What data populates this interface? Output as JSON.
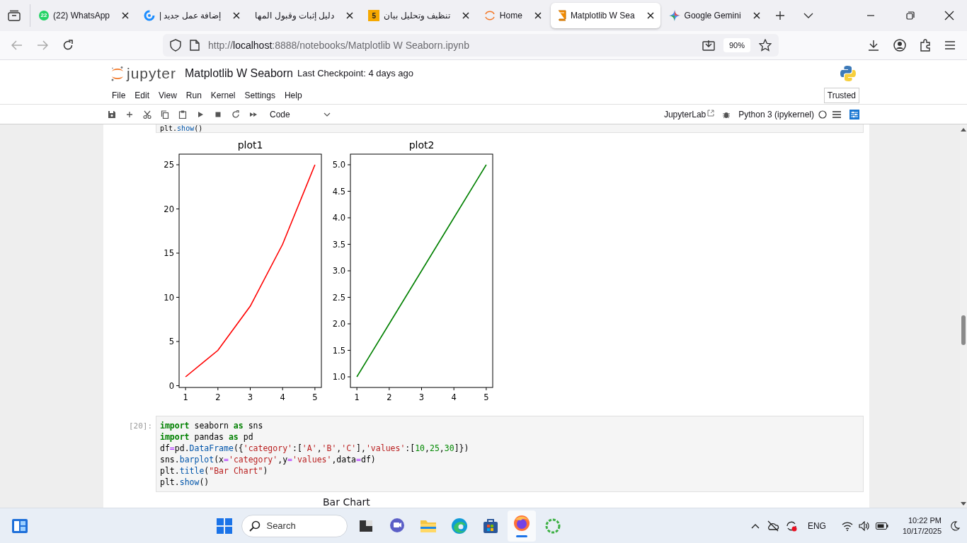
{
  "browser": {
    "tabs": [
      {
        "kind": "whatsapp",
        "badge": "22",
        "label": "(22) WhatsApp",
        "selected": false
      },
      {
        "kind": "ring",
        "label": "إضافة عمل جديد |",
        "selected": false
      },
      {
        "kind": "plain",
        "label": "دليل إثبات وقبول المها",
        "selected": false
      },
      {
        "kind": "number",
        "badge": "5",
        "label": "تنظيف وتحليل بيان",
        "selected": false
      },
      {
        "kind": "arc",
        "label": "Home",
        "selected": false
      },
      {
        "kind": "book",
        "label": "Matplotlib W Sea",
        "selected": true
      },
      {
        "kind": "spark",
        "label": "Google Gemini",
        "selected": false
      }
    ],
    "address": "http://**localhost**:8888/notebooks/Matplotlib W Seaborn.ipynb",
    "zoom": "90%"
  },
  "jupyter": {
    "logo": "jupyter",
    "title": "Matplotlib W Seaborn",
    "checkpoint": "Last Checkpoint: 4 days ago",
    "menu": [
      "File",
      "Edit",
      "View",
      "Run",
      "Kernel",
      "Settings",
      "Help"
    ],
    "trusted": "Trusted",
    "cell_type": "Code",
    "lab_link": "JupyterLab",
    "kernel": "Python 3 (ipykernel)"
  },
  "notebook": {
    "cut_line": [
      {
        "kind": "name",
        "text": "plt."
      },
      {
        "kind": "function",
        "text": "show"
      },
      {
        "kind": "name",
        "text": "()"
      }
    ],
    "outputs": [
      {
        "chart_data": {
          "type": "line",
          "title": "plot1",
          "x": [
            1,
            2,
            3,
            4,
            5
          ],
          "series": [
            {
              "color": "#ff0000",
              "values": [
                1,
                4,
                9,
                16,
                25
              ]
            }
          ],
          "xlim": [
            0.8,
            5.2
          ],
          "ylim": [
            -0.2,
            26.2
          ],
          "xticks": [
            {
              "value": 1,
              "label": "1"
            },
            {
              "value": 2,
              "label": "2"
            },
            {
              "value": 3,
              "label": "3"
            },
            {
              "value": 4,
              "label": "4"
            },
            {
              "value": 5,
              "label": "5"
            }
          ],
          "yticks": [
            {
              "value": 0,
              "label": "0"
            },
            {
              "value": 5,
              "label": "5"
            },
            {
              "value": 10,
              "label": "10"
            },
            {
              "value": 15,
              "label": "15"
            },
            {
              "value": 20,
              "label": "20"
            },
            {
              "value": 25,
              "label": "25"
            }
          ]
        }
      },
      {
        "chart_data": {
          "type": "line",
          "title": "plot2",
          "x": [
            1,
            2,
            3,
            4,
            5
          ],
          "series": [
            {
              "color": "#008000",
              "values": [
                1,
                2,
                3,
                4,
                5
              ]
            }
          ],
          "xlim": [
            0.8,
            5.2
          ],
          "ylim": [
            0.8,
            5.2
          ],
          "xticks": [
            {
              "value": 1,
              "label": "1"
            },
            {
              "value": 2,
              "label": "2"
            },
            {
              "value": 3,
              "label": "3"
            },
            {
              "value": 4,
              "label": "4"
            },
            {
              "value": 5,
              "label": "5"
            }
          ],
          "yticks": [
            {
              "value": 1,
              "label": "1.0"
            },
            {
              "value": 1.5,
              "label": "1.5"
            },
            {
              "value": 2,
              "label": "2.0"
            },
            {
              "value": 2.5,
              "label": "2.5"
            },
            {
              "value": 3,
              "label": "3.0"
            },
            {
              "value": 3.5,
              "label": "3.5"
            },
            {
              "value": 4,
              "label": "4.0"
            },
            {
              "value": 4.5,
              "label": "4.5"
            },
            {
              "value": 5,
              "label": "5.0"
            }
          ]
        }
      }
    ],
    "cell": {
      "prompt": "[20]:",
      "lines": [
        [
          {
            "kind": "keyword",
            "text": "import"
          },
          {
            "kind": "name",
            "text": " seaborn "
          },
          {
            "kind": "keyword",
            "text": "as"
          },
          {
            "kind": "name",
            "text": " sns"
          }
        ],
        [
          {
            "kind": "keyword",
            "text": "import"
          },
          {
            "kind": "name",
            "text": " pandas "
          },
          {
            "kind": "keyword",
            "text": "as"
          },
          {
            "kind": "name",
            "text": " pd"
          }
        ],
        [
          {
            "kind": "name",
            "text": "df"
          },
          {
            "kind": "operator",
            "text": "="
          },
          {
            "kind": "name",
            "text": "pd."
          },
          {
            "kind": "function",
            "text": "DataFrame"
          },
          {
            "kind": "name",
            "text": "({"
          },
          {
            "kind": "string",
            "text": "'category'"
          },
          {
            "kind": "name",
            "text": ":["
          },
          {
            "kind": "string",
            "text": "'A'"
          },
          {
            "kind": "name",
            "text": ","
          },
          {
            "kind": "string",
            "text": "'B'"
          },
          {
            "kind": "name",
            "text": ","
          },
          {
            "kind": "string",
            "text": "'C'"
          },
          {
            "kind": "name",
            "text": "],"
          },
          {
            "kind": "string",
            "text": "'values'"
          },
          {
            "kind": "name",
            "text": ":["
          },
          {
            "kind": "number",
            "text": "10"
          },
          {
            "kind": "name",
            "text": ","
          },
          {
            "kind": "number",
            "text": "25"
          },
          {
            "kind": "name",
            "text": ","
          },
          {
            "kind": "number",
            "text": "30"
          },
          {
            "kind": "name",
            "text": "]})"
          }
        ],
        [
          {
            "kind": "name",
            "text": "sns."
          },
          {
            "kind": "function",
            "text": "barplot"
          },
          {
            "kind": "name",
            "text": "(x"
          },
          {
            "kind": "operator",
            "text": "="
          },
          {
            "kind": "string",
            "text": "'category'"
          },
          {
            "kind": "name",
            "text": ",y"
          },
          {
            "kind": "operator",
            "text": "="
          },
          {
            "kind": "string",
            "text": "'values'"
          },
          {
            "kind": "name",
            "text": ",data"
          },
          {
            "kind": "operator",
            "text": "="
          },
          {
            "kind": "name",
            "text": "df)"
          }
        ],
        [
          {
            "kind": "name",
            "text": "plt."
          },
          {
            "kind": "function",
            "text": "title"
          },
          {
            "kind": "name",
            "text": "("
          },
          {
            "kind": "string",
            "text": "\"Bar Chart\""
          },
          {
            "kind": "name",
            "text": ")"
          }
        ],
        [
          {
            "kind": "name",
            "text": "plt."
          },
          {
            "kind": "function",
            "text": "show"
          },
          {
            "kind": "name",
            "text": "()"
          }
        ]
      ]
    },
    "next_output_title": "Bar Chart"
  },
  "taskbar": {
    "search": "Search",
    "apps": [
      {
        "kind": "start",
        "selected": false
      },
      {
        "kind": "terminal",
        "selected": false
      },
      {
        "kind": "chat",
        "selected": false
      },
      {
        "kind": "folder",
        "selected": false
      },
      {
        "kind": "edge",
        "selected": false
      },
      {
        "kind": "store",
        "selected": false
      },
      {
        "kind": "firefox",
        "selected": true
      },
      {
        "kind": "ringapp",
        "selected": false
      }
    ],
    "language": "ENG",
    "time": "10:22 PM",
    "date": "10/17/2025"
  }
}
